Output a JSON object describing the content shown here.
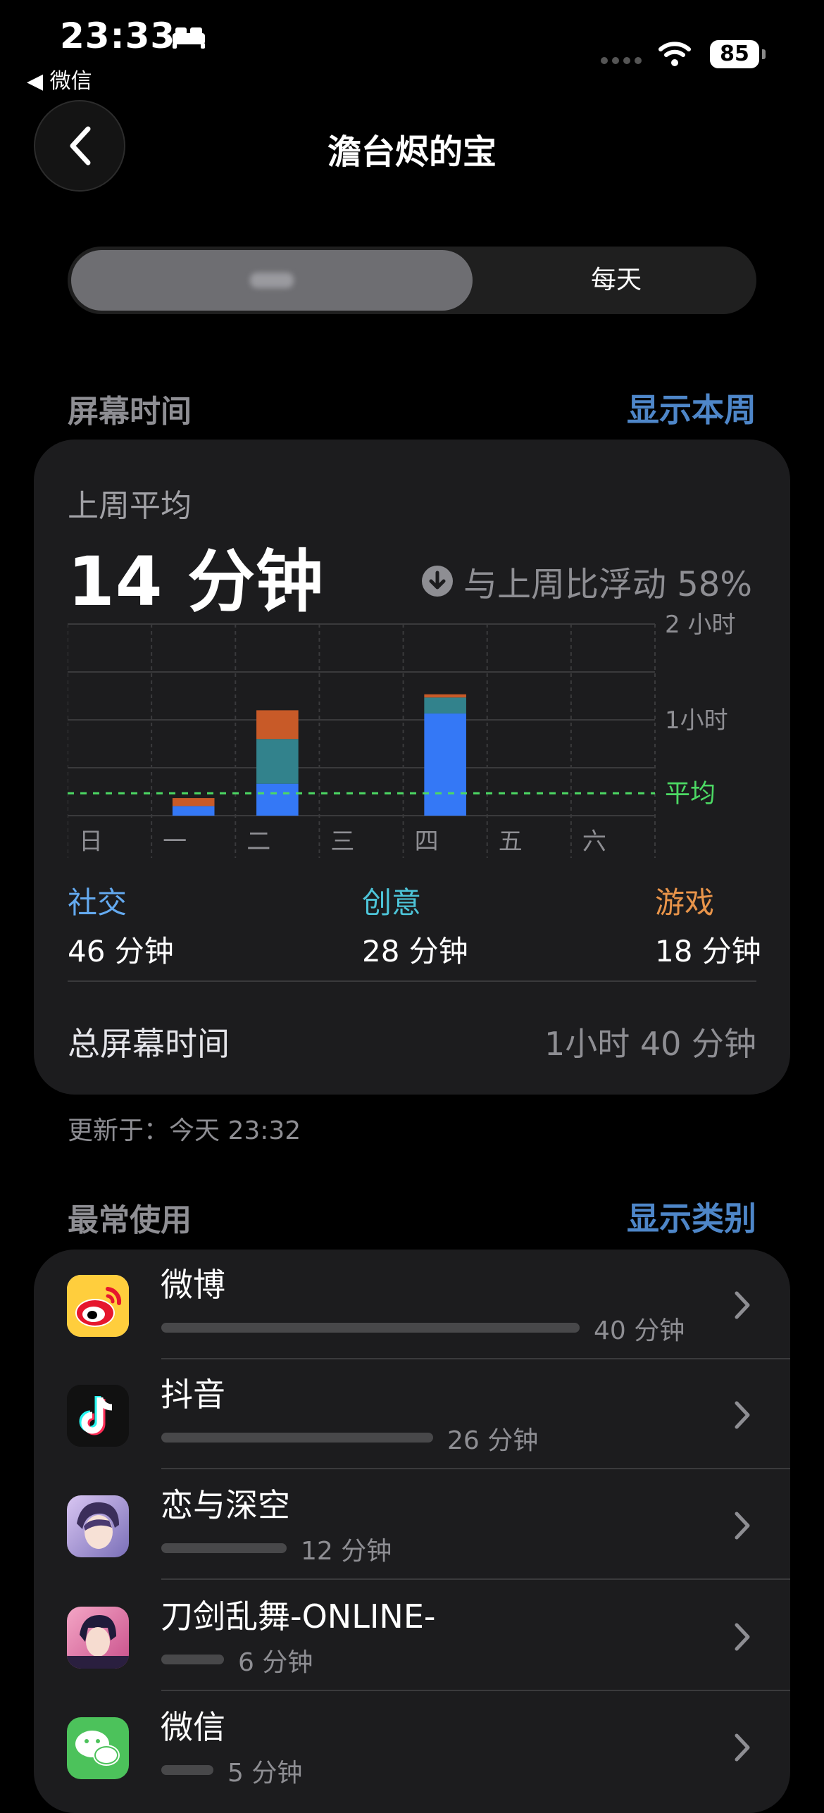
{
  "status": {
    "time": "23:33",
    "back_app": "◀ 微信",
    "battery": "85"
  },
  "nav": {
    "title": "澹台烬的宝"
  },
  "segment": {
    "other_label": "每天"
  },
  "screen_time": {
    "header": "屏幕时间",
    "link": "显示本周",
    "avg_label": "上周平均",
    "avg_value": "14 分钟",
    "compare": "与上周比浮动 58%",
    "categories": [
      {
        "name": "社交",
        "value": "46 分钟",
        "color": "#64aaf0"
      },
      {
        "name": "创意",
        "value": "28 分钟",
        "color": "#4dc4d8"
      },
      {
        "name": "游戏",
        "value": "18 分钟",
        "color": "#e8944a"
      }
    ],
    "total_label": "总屏幕时间",
    "total_value": "1小时 40 分钟",
    "updated": "更新于：今天 23:32"
  },
  "chart_data": {
    "type": "bar",
    "categories": [
      "日",
      "一",
      "二",
      "三",
      "四",
      "五",
      "六"
    ],
    "series": [
      {
        "name": "社交",
        "color": "#3478f6",
        "values": [
          0,
          6,
          20,
          0,
          64,
          0,
          0
        ]
      },
      {
        "name": "创意",
        "color": "#32828c",
        "values": [
          0,
          0,
          28,
          0,
          10,
          0,
          0
        ]
      },
      {
        "name": "游戏",
        "color": "#c85a28",
        "values": [
          0,
          5,
          18,
          0,
          2,
          0,
          0
        ]
      }
    ],
    "y_tick_labels": [
      "2 小时",
      "1小时"
    ],
    "avg_label": "平均",
    "average_minutes": 14,
    "ylim": [
      0,
      120
    ],
    "avg_line_color": "#4cd964"
  },
  "most_used": {
    "header": "最常使用",
    "link": "显示类别",
    "apps": [
      {
        "name": "微博",
        "time": "40 分钟",
        "icon": "weibo-icon",
        "minutes": 40
      },
      {
        "name": "抖音",
        "time": "26 分钟",
        "icon": "douyin-icon",
        "minutes": 26
      },
      {
        "name": "恋与深空",
        "time": "12 分钟",
        "icon": "lianyu-icon",
        "minutes": 12
      },
      {
        "name": "刀剑乱舞-ONLINE-",
        "time": "6 分钟",
        "icon": "touken-icon",
        "minutes": 6
      },
      {
        "name": "微信",
        "time": "5 分钟",
        "icon": "wechat-icon",
        "minutes": 5
      }
    ]
  }
}
